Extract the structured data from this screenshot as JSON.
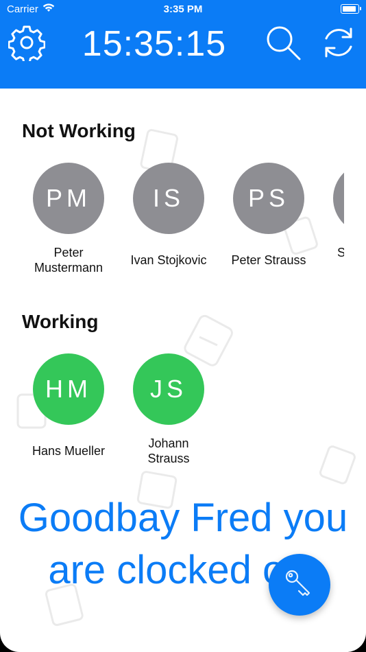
{
  "status_bar": {
    "carrier": "Carrier",
    "time": "3:35 PM"
  },
  "header": {
    "clock": "15:35:15",
    "settings_icon": "gear-icon",
    "search_icon": "search-icon",
    "refresh_icon": "refresh-icon"
  },
  "sections": {
    "not_working": {
      "title": "Not Working",
      "people": [
        {
          "initials": "PM",
          "name_line1": "Peter",
          "name_line2": "Mustermann"
        },
        {
          "initials": "IS",
          "name_line1": "Ivan Stojkovic",
          "name_line2": ""
        },
        {
          "initials": "PS",
          "name_line1": "Peter Strauss",
          "name_line2": ""
        },
        {
          "initials": "",
          "name_line1": "S",
          "name_line2": ""
        }
      ]
    },
    "working": {
      "title": "Working",
      "people": [
        {
          "initials": "HM",
          "name_line1": "Hans Mueller",
          "name_line2": ""
        },
        {
          "initials": "JS",
          "name_line1": "Johann",
          "name_line2": "Strauss"
        }
      ]
    }
  },
  "message": {
    "line1": "Goodbay Fred you",
    "line2": "are clocked out"
  },
  "fab": {
    "icon": "key-icon"
  },
  "colors": {
    "accent": "#0b7cf6",
    "not_working_avatar": "#8e8e93",
    "working_avatar": "#34c759"
  }
}
